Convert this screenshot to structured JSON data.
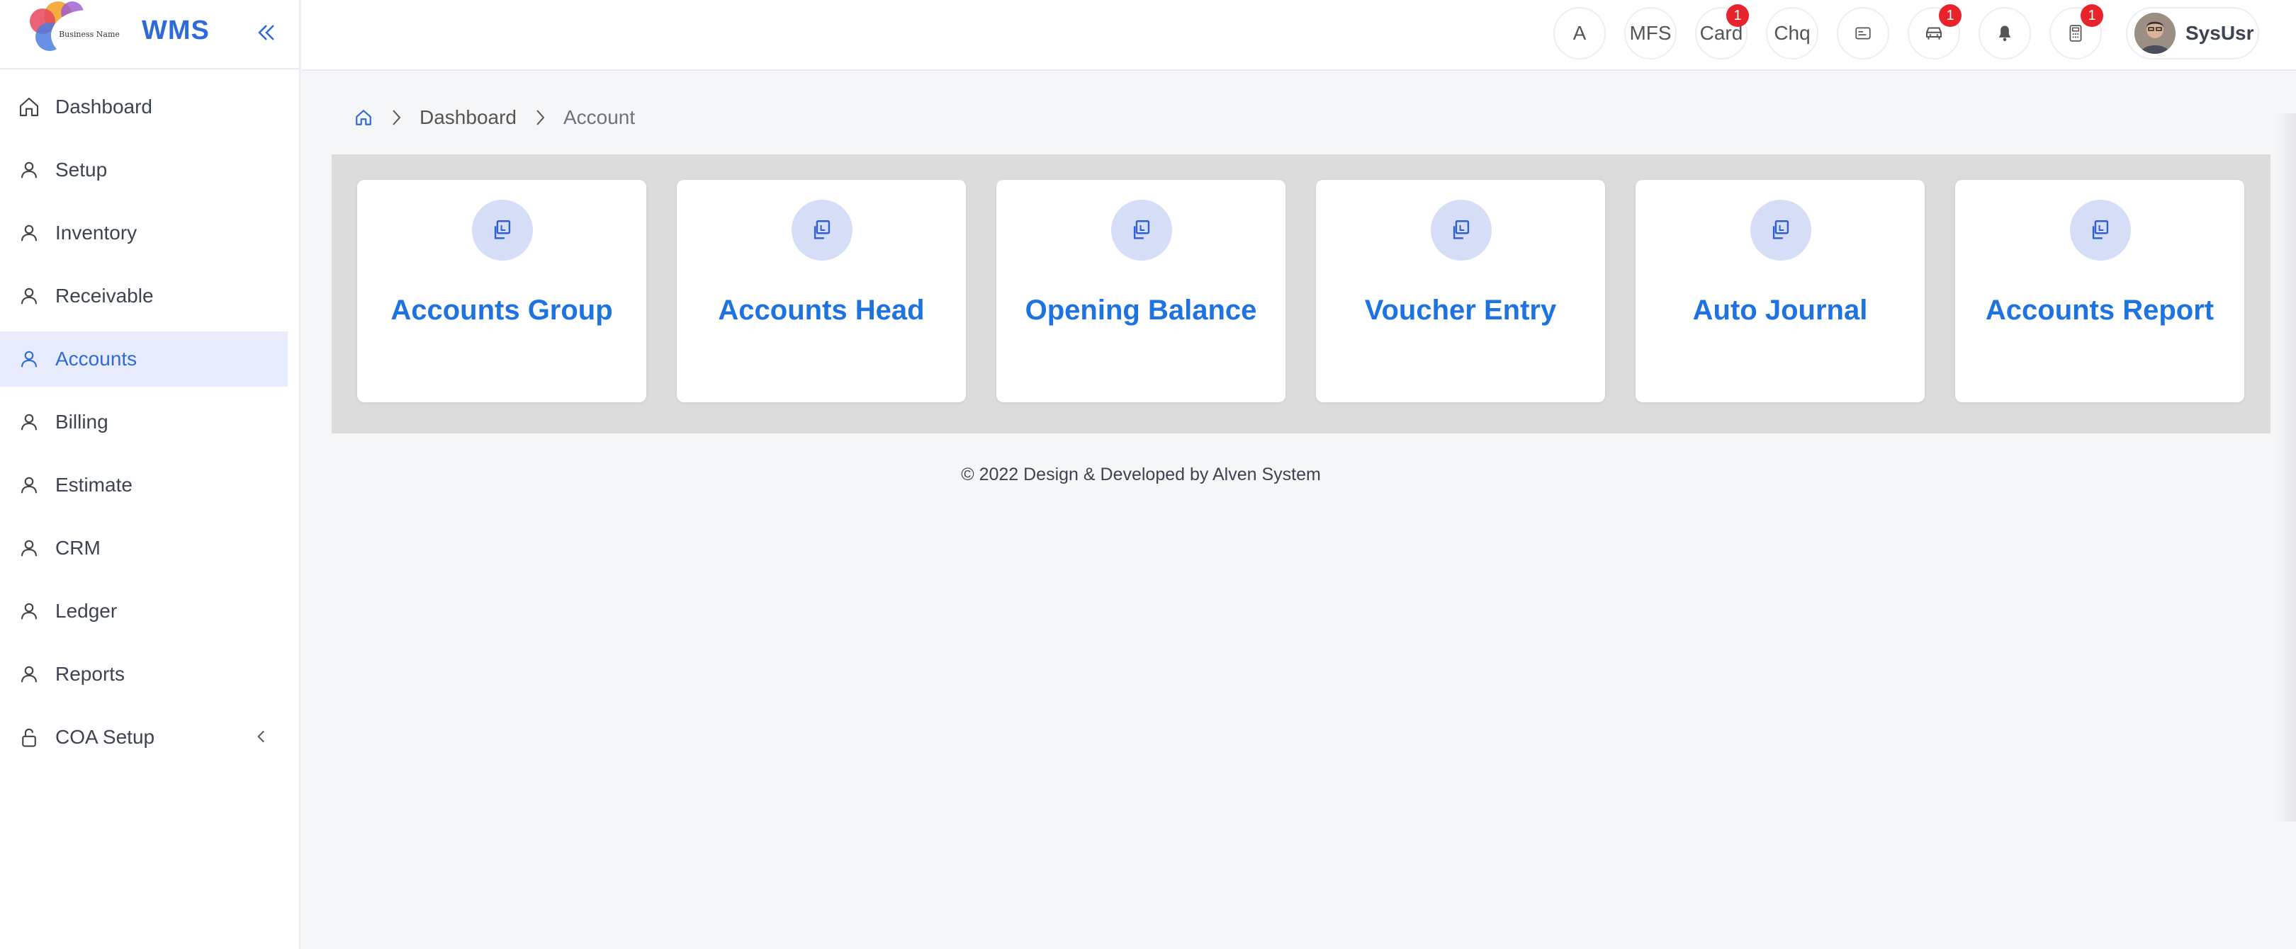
{
  "brand": {
    "logo_text": "Business Name",
    "app_name": "WMS"
  },
  "sidebar": {
    "items": [
      {
        "label": "Dashboard",
        "icon": "home-icon",
        "active": false
      },
      {
        "label": "Setup",
        "icon": "user-icon",
        "active": false
      },
      {
        "label": "Inventory",
        "icon": "user-icon",
        "active": false
      },
      {
        "label": "Receivable",
        "icon": "user-icon",
        "active": false
      },
      {
        "label": "Accounts",
        "icon": "user-icon",
        "active": true
      },
      {
        "label": "Billing",
        "icon": "user-icon",
        "active": false
      },
      {
        "label": "Estimate",
        "icon": "user-icon",
        "active": false
      },
      {
        "label": "CRM",
        "icon": "user-icon",
        "active": false
      },
      {
        "label": "Ledger",
        "icon": "user-icon",
        "active": false
      },
      {
        "label": "Reports",
        "icon": "user-icon",
        "active": false
      },
      {
        "label": "COA Setup",
        "icon": "lock-icon",
        "active": false
      }
    ]
  },
  "topbar": {
    "buttons": [
      {
        "label": "A",
        "badge": ""
      },
      {
        "label": "MFS",
        "badge": ""
      },
      {
        "label": "Card",
        "badge": "1"
      },
      {
        "label": "Chq",
        "badge": ""
      },
      {
        "label": "",
        "icon": "id-card-icon",
        "badge": ""
      },
      {
        "label": "",
        "icon": "car-icon",
        "badge": "1"
      },
      {
        "label": "",
        "icon": "bell-icon",
        "badge": ""
      },
      {
        "label": "",
        "icon": "calculator-icon",
        "badge": "1"
      }
    ],
    "user": {
      "name": "SysUsr"
    }
  },
  "breadcrumb": {
    "home_icon": "home-icon",
    "items": [
      "Dashboard",
      "Account"
    ]
  },
  "cards": [
    {
      "title": "Accounts Group",
      "icon": "copy-icon"
    },
    {
      "title": "Accounts Head",
      "icon": "copy-icon"
    },
    {
      "title": "Opening Balance",
      "icon": "copy-icon"
    },
    {
      "title": "Voucher Entry",
      "icon": "copy-icon"
    },
    {
      "title": "Auto Journal",
      "icon": "copy-icon"
    },
    {
      "title": "Accounts Report",
      "icon": "copy-icon"
    }
  ],
  "footer": {
    "text": "© 2022 Design & Developed by Alven System"
  },
  "colors": {
    "accent": "#1f73e0",
    "brand": "#2f6bd8",
    "active_bg": "#e7ebfb",
    "badge": "#e8232c",
    "icon_circle": "#d6ddf7",
    "panel_bg": "#dcdcdc"
  }
}
